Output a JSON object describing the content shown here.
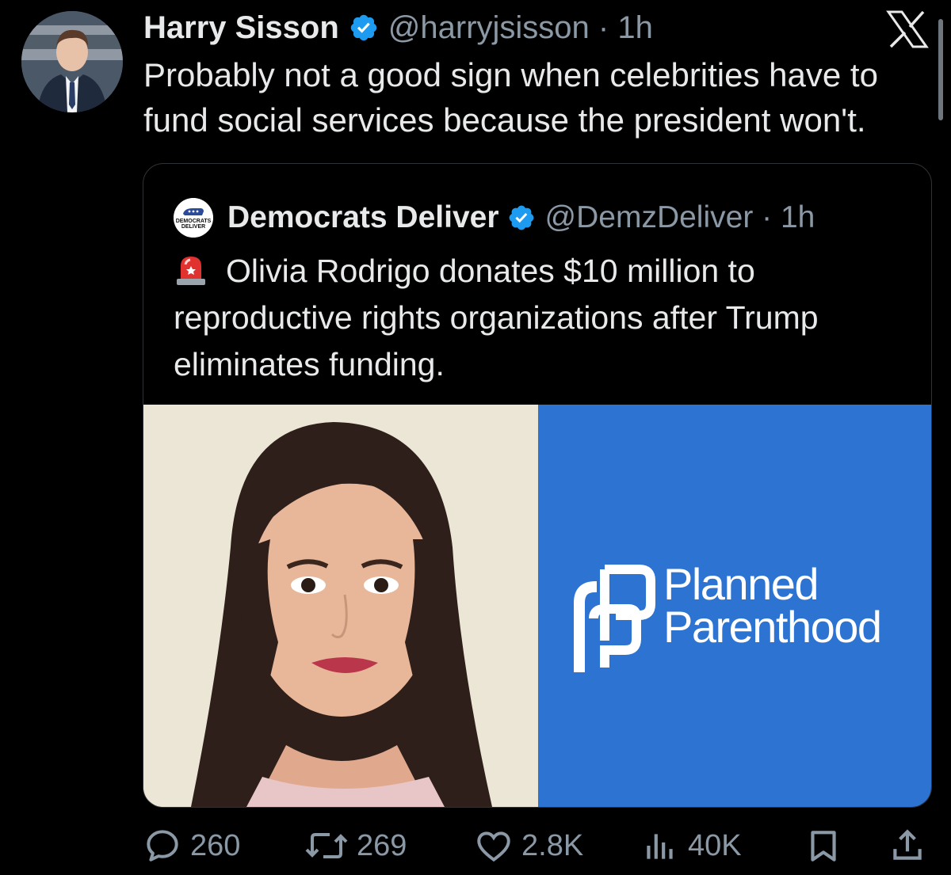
{
  "tweet": {
    "author_name": "Harry Sisson",
    "handle_time": "@harryjsisson · 1h",
    "text": "Probably not a good sign when celebrities have to fund social services because the president won't."
  },
  "quoted_tweet": {
    "author_name": "Democrats Deliver",
    "handle_time": "@DemzDeliver · 1h",
    "avatar_text": "DEMOCRATS DELIVER",
    "text": "Olivia Rodrigo donates $10 million to reproductive rights organizations after Trump eliminates funding.",
    "logo_line1": "Planned",
    "logo_line2": "Parenthood"
  },
  "metrics": {
    "replies": "260",
    "reposts": "269",
    "likes": "2.8K",
    "views": "40K"
  },
  "colors": {
    "background": "#000000",
    "verified": "#1d9bf0",
    "secondary_text": "#8b98a5",
    "planned_parenthood_blue": "#2c73d2"
  },
  "icons": [
    "verified-badge-icon",
    "x-logo-icon",
    "siren-emoji-icon",
    "reply-icon",
    "repost-icon",
    "like-icon",
    "views-icon",
    "bookmark-icon",
    "share-icon"
  ]
}
